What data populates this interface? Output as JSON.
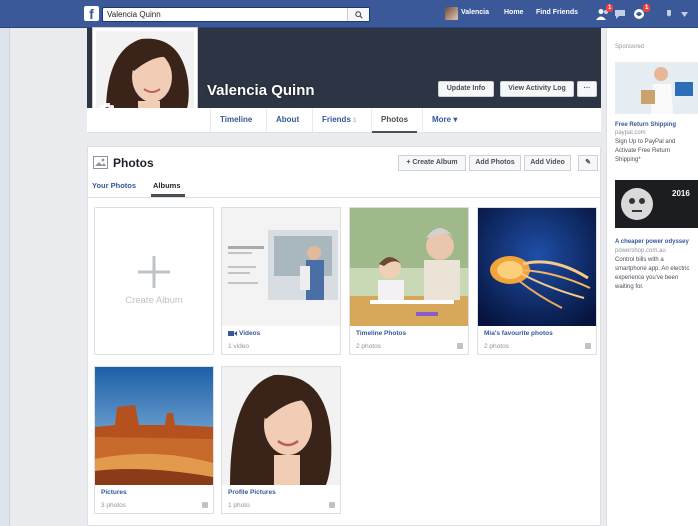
{
  "topbar": {
    "search_value": "Valencia Quinn",
    "user_name": "Valencia",
    "home_label": "Home",
    "find_friends_label": "Find Friends",
    "friend_requests_badge": "1",
    "notifications_badge": "1"
  },
  "profile": {
    "name": "Valencia Quinn",
    "update_info_label": "Update Info",
    "activity_log_label": "View Activity Log",
    "more_actions_label": "···",
    "tabs": {
      "timeline": "Timeline",
      "about": "About",
      "friends": "Friends",
      "friends_count": "1",
      "photos": "Photos",
      "more": "More ▾"
    }
  },
  "photos": {
    "title": "Photos",
    "create_album_label": "+ Create Album",
    "add_photos_label": "Add Photos",
    "add_video_label": "Add Video",
    "edit_label": "✎",
    "subtabs": {
      "your_photos": "Your Photos",
      "albums": "Albums"
    },
    "create_album_tile": "Create Album",
    "albums": [
      {
        "name": "Videos",
        "count": "1 video"
      },
      {
        "name": "Timeline Photos",
        "count": "2 photos"
      },
      {
        "name": "Mia's favourite photos",
        "count": "2 photos"
      },
      {
        "name": "Pictures",
        "count": "3 photos"
      },
      {
        "name": "Profile Pictures",
        "count": "1 photo"
      }
    ]
  },
  "sidebar": {
    "sponsored_label": "Sponsored",
    "ad1": {
      "title": "Free Return Shipping",
      "domain": "paypal.com",
      "body": [
        "Sign Up to PayPal and",
        "Activate Free Return",
        "Shipping*"
      ]
    },
    "ad2": {
      "image_text": "2016",
      "title": "A cheaper power odyssey",
      "domain": "powershop.com.au",
      "body": [
        "Control bills with a",
        "smartphone app. An electric",
        "experience you've been",
        "waiting for."
      ]
    }
  },
  "colors": {
    "brand": "#3b5998",
    "link": "#365899",
    "cover": "#2d3444"
  }
}
